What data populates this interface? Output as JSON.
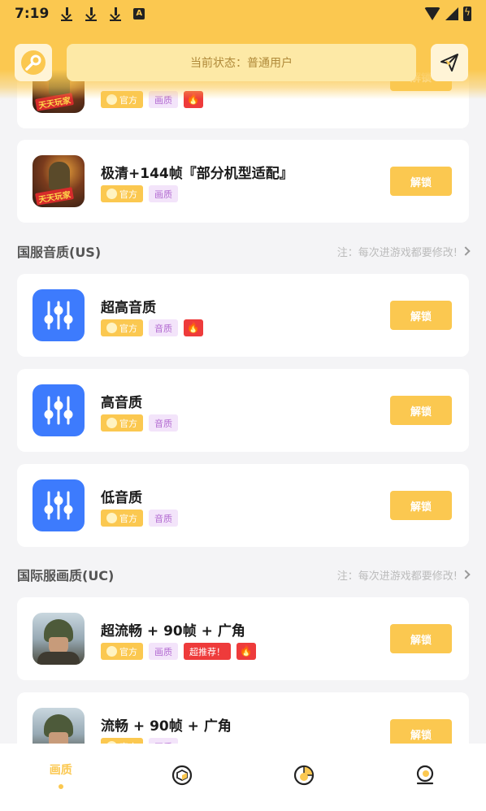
{
  "status_bar": {
    "time": "7:19"
  },
  "header": {
    "state_text": "当前状态：普通用户"
  },
  "items": [
    {
      "title": "",
      "tags": [
        "官方",
        "画质"
      ],
      "hot": true,
      "button": "解锁",
      "thumb": "pubg-mobile-cn-game-icon"
    },
    {
      "title": "极清+144帧『部分机型适配』",
      "tags": [
        "官方",
        "画质"
      ],
      "hot": false,
      "button": "解锁",
      "thumb": "pubg-mobile-cn-game-icon"
    },
    {
      "title": "超高音质",
      "tags": [
        "官方",
        "音质"
      ],
      "hot": true,
      "button": "解锁",
      "thumb": "equalizer-icon"
    },
    {
      "title": "高音质",
      "tags": [
        "官方",
        "音质"
      ],
      "hot": false,
      "button": "解锁",
      "thumb": "equalizer-icon"
    },
    {
      "title": "低音质",
      "tags": [
        "官方",
        "音质"
      ],
      "hot": false,
      "button": "解锁",
      "thumb": "equalizer-icon"
    },
    {
      "title": "超流畅 + 90帧 + 广角",
      "tags": [
        "官方",
        "画质",
        "超推荐！"
      ],
      "hot": true,
      "button": "解锁",
      "thumb": "pubg-global-game-icon"
    },
    {
      "title": "流畅 + 90帧 + 广角",
      "tags": [
        "官方",
        "画质"
      ],
      "hot": false,
      "button": "解锁",
      "thumb": "pubg-global-game-icon"
    }
  ],
  "game_badge": "天天玩家",
  "sections": [
    {
      "title": "国服音质(US)",
      "note": "注：每次进游戏都要修改!"
    },
    {
      "title": "国际服画质(UC)",
      "note": "注：每次进游戏都要修改!"
    }
  ],
  "bottom_nav": [
    {
      "label": "画质",
      "active": true,
      "icon": "quality-icon"
    },
    {
      "label": "",
      "active": false,
      "icon": "cube-icon"
    },
    {
      "label": "",
      "active": false,
      "icon": "pie-chart-icon"
    },
    {
      "label": "",
      "active": false,
      "icon": "profile-icon"
    }
  ],
  "colors": {
    "accent": "#fbc850",
    "eq_blue": "#3d7bfd",
    "hot_red": "#ee3b3b",
    "tag_purple": "#b36bd1"
  }
}
